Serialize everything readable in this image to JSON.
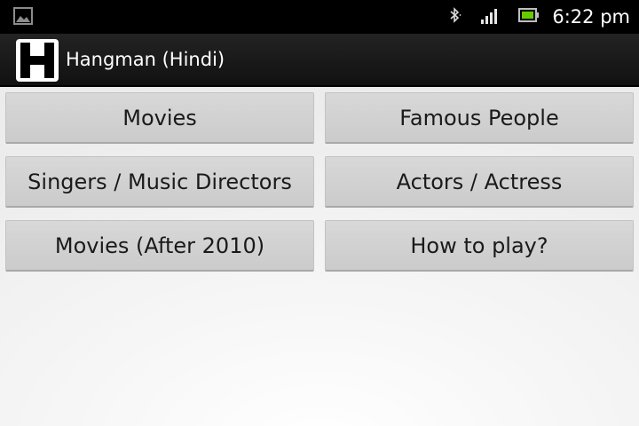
{
  "status_bar": {
    "time": "6:22 pm",
    "icons": [
      "gallery-icon",
      "bluetooth-icon",
      "signal-icon",
      "battery-icon"
    ],
    "battery_color": "#66cc00"
  },
  "action_bar": {
    "logo_letter": "H",
    "title": "Hangman (Hindi)"
  },
  "categories": [
    {
      "label": "Movies"
    },
    {
      "label": "Famous People"
    },
    {
      "label": "Singers / Music Directors"
    },
    {
      "label": "Actors / Actress"
    },
    {
      "label": "Movies (After 2010)"
    },
    {
      "label": "How to play?"
    }
  ]
}
